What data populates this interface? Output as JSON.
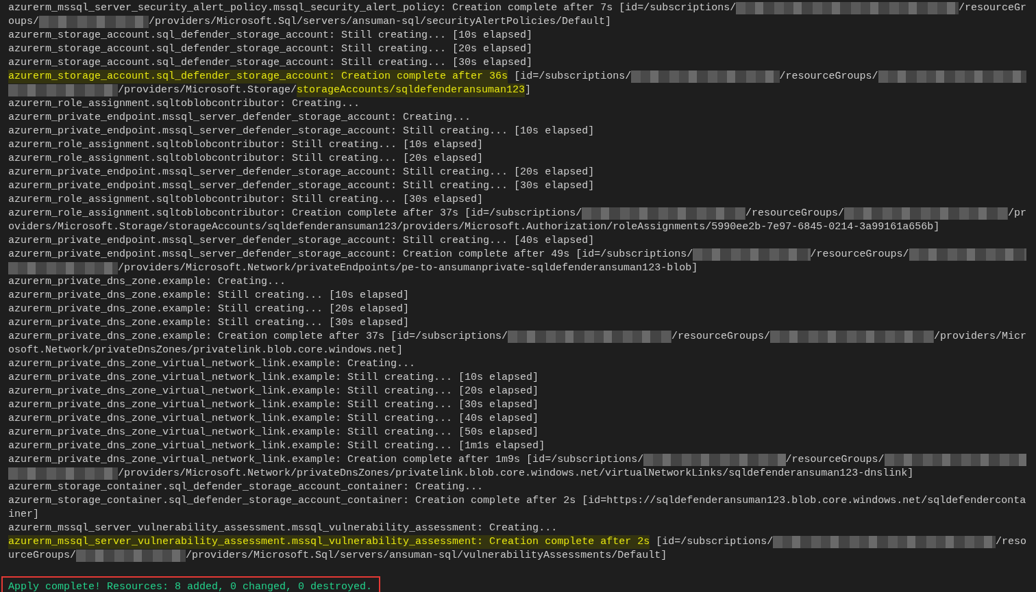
{
  "terminal": {
    "rows": [
      {
        "segments": [
          {
            "kind": "text",
            "text": "azurerm_mssql_server_security_alert_policy.mssql_security_alert_policy: Creation complete after 7s [id=/subscriptions/"
          },
          {
            "kind": "redacted"
          },
          {
            "kind": "text",
            "text": "/resourceGr"
          }
        ]
      },
      {
        "segments": [
          {
            "kind": "text",
            "text": "oups/"
          },
          {
            "kind": "redacted_short"
          },
          {
            "kind": "text",
            "text": "/providers/Microsoft.Sql/servers/ansuman-sql/securityAlertPolicies/Default]"
          }
        ]
      },
      {
        "segments": [
          {
            "kind": "text",
            "text": "azurerm_storage_account.sql_defender_storage_account: Still creating... [10s elapsed]"
          }
        ]
      },
      {
        "segments": [
          {
            "kind": "text",
            "text": "azurerm_storage_account.sql_defender_storage_account: Still creating... [20s elapsed]"
          }
        ]
      },
      {
        "segments": [
          {
            "kind": "text",
            "text": "azurerm_storage_account.sql_defender_storage_account: Still creating... [30s elapsed]"
          }
        ]
      },
      {
        "segments": [
          {
            "kind": "highlight",
            "text": "azurerm_storage_account.sql_defender_storage_account: Creation complete after 36s"
          },
          {
            "kind": "text",
            "text": " [id=/subscriptions/"
          },
          {
            "kind": "redacted"
          },
          {
            "kind": "text",
            "text": "/resourceGroups/"
          },
          {
            "kind": "redacted"
          }
        ]
      },
      {
        "segments": [
          {
            "kind": "redacted_short"
          },
          {
            "kind": "text",
            "text": "/providers/Microsoft.Storage/"
          },
          {
            "kind": "highlight",
            "text": "storageAccounts/sqldefenderansuman123"
          },
          {
            "kind": "text",
            "text": "]"
          }
        ]
      },
      {
        "segments": [
          {
            "kind": "text",
            "text": "azurerm_role_assignment.sqltoblobcontributor: Creating..."
          }
        ]
      },
      {
        "segments": [
          {
            "kind": "text",
            "text": "azurerm_private_endpoint.mssql_server_defender_storage_account: Creating..."
          }
        ]
      },
      {
        "segments": [
          {
            "kind": "text",
            "text": "azurerm_private_endpoint.mssql_server_defender_storage_account: Still creating... [10s elapsed]"
          }
        ]
      },
      {
        "segments": [
          {
            "kind": "text",
            "text": "azurerm_role_assignment.sqltoblobcontributor: Still creating... [10s elapsed]"
          }
        ]
      },
      {
        "segments": [
          {
            "kind": "text",
            "text": "azurerm_role_assignment.sqltoblobcontributor: Still creating... [20s elapsed]"
          }
        ]
      },
      {
        "segments": [
          {
            "kind": "text",
            "text": "azurerm_private_endpoint.mssql_server_defender_storage_account: Still creating... [20s elapsed]"
          }
        ]
      },
      {
        "segments": [
          {
            "kind": "text",
            "text": "azurerm_private_endpoint.mssql_server_defender_storage_account: Still creating... [30s elapsed]"
          }
        ]
      },
      {
        "segments": [
          {
            "kind": "text",
            "text": "azurerm_role_assignment.sqltoblobcontributor: Still creating... [30s elapsed]"
          }
        ]
      },
      {
        "segments": [
          {
            "kind": "text",
            "text": "azurerm_role_assignment.sqltoblobcontributor: Creation complete after 37s [id=/subscriptions/"
          },
          {
            "kind": "redacted"
          },
          {
            "kind": "text",
            "text": "/resourceGroups/"
          },
          {
            "kind": "redacted"
          },
          {
            "kind": "text",
            "text": "/pr"
          }
        ]
      },
      {
        "segments": [
          {
            "kind": "text",
            "text": "oviders/Microsoft.Storage/storageAccounts/sqldefenderansuman123/providers/Microsoft.Authorization/roleAssignments/5990ee2b-7e97-6845-0214-3a99161a656b]"
          }
        ]
      },
      {
        "segments": [
          {
            "kind": "text",
            "text": "azurerm_private_endpoint.mssql_server_defender_storage_account: Still creating... [40s elapsed]"
          }
        ]
      },
      {
        "segments": [
          {
            "kind": "text",
            "text": "azurerm_private_endpoint.mssql_server_defender_storage_account: Creation complete after 49s [id=/subscriptions/"
          },
          {
            "kind": "redacted"
          },
          {
            "kind": "text",
            "text": "/resourceGroups/"
          },
          {
            "kind": "redacted"
          }
        ]
      },
      {
        "segments": [
          {
            "kind": "redacted_short"
          },
          {
            "kind": "text",
            "text": "/providers/Microsoft.Network/privateEndpoints/pe-to-ansumanprivate-sqldefenderansuman123-blob]"
          }
        ]
      },
      {
        "segments": [
          {
            "kind": "text",
            "text": "azurerm_private_dns_zone.example: Creating..."
          }
        ]
      },
      {
        "segments": [
          {
            "kind": "text",
            "text": "azurerm_private_dns_zone.example: Still creating... [10s elapsed]"
          }
        ]
      },
      {
        "segments": [
          {
            "kind": "text",
            "text": "azurerm_private_dns_zone.example: Still creating... [20s elapsed]"
          }
        ]
      },
      {
        "segments": [
          {
            "kind": "text",
            "text": "azurerm_private_dns_zone.example: Still creating... [30s elapsed]"
          }
        ]
      },
      {
        "segments": [
          {
            "kind": "text",
            "text": "azurerm_private_dns_zone.example: Creation complete after 37s [id=/subscriptions/"
          },
          {
            "kind": "redacted"
          },
          {
            "kind": "text",
            "text": "/resourceGroups/"
          },
          {
            "kind": "redacted"
          },
          {
            "kind": "text",
            "text": "/providers/Micr"
          }
        ]
      },
      {
        "segments": [
          {
            "kind": "text",
            "text": "osoft.Network/privateDnsZones/privatelink.blob.core.windows.net]"
          }
        ]
      },
      {
        "segments": [
          {
            "kind": "text",
            "text": "azurerm_private_dns_zone_virtual_network_link.example: Creating..."
          }
        ]
      },
      {
        "segments": [
          {
            "kind": "text",
            "text": "azurerm_private_dns_zone_virtual_network_link.example: Still creating... [10s elapsed]"
          }
        ]
      },
      {
        "segments": [
          {
            "kind": "text",
            "text": "azurerm_private_dns_zone_virtual_network_link.example: Still creating... [20s elapsed]"
          }
        ]
      },
      {
        "segments": [
          {
            "kind": "text",
            "text": "azurerm_private_dns_zone_virtual_network_link.example: Still creating... [30s elapsed]"
          }
        ]
      },
      {
        "segments": [
          {
            "kind": "text",
            "text": "azurerm_private_dns_zone_virtual_network_link.example: Still creating... [40s elapsed]"
          }
        ]
      },
      {
        "segments": [
          {
            "kind": "text",
            "text": "azurerm_private_dns_zone_virtual_network_link.example: Still creating... [50s elapsed]"
          }
        ]
      },
      {
        "segments": [
          {
            "kind": "text",
            "text": "azurerm_private_dns_zone_virtual_network_link.example: Still creating... [1m1s elapsed]"
          }
        ]
      },
      {
        "segments": [
          {
            "kind": "text",
            "text": "azurerm_private_dns_zone_virtual_network_link.example: Creation complete after 1m9s [id=/subscriptions/"
          },
          {
            "kind": "redacted"
          },
          {
            "kind": "text",
            "text": "/resourceGroups/"
          },
          {
            "kind": "redacted"
          }
        ]
      },
      {
        "segments": [
          {
            "kind": "redacted_short"
          },
          {
            "kind": "text",
            "text": "/providers/Microsoft.Network/privateDnsZones/privatelink.blob.core.windows.net/virtualNetworkLinks/sqldefenderansuman123-dnslink]"
          }
        ]
      },
      {
        "segments": [
          {
            "kind": "text",
            "text": "azurerm_storage_container.sql_defender_storage_account_container: Creating..."
          }
        ]
      },
      {
        "segments": [
          {
            "kind": "text",
            "text": "azurerm_storage_container.sql_defender_storage_account_container: Creation complete after 2s [id=https://sqldefenderansuman123.blob.core.windows.net/sqldefenderconta"
          }
        ]
      },
      {
        "segments": [
          {
            "kind": "text",
            "text": "iner]"
          }
        ]
      },
      {
        "segments": [
          {
            "kind": "text",
            "text": "azurerm_mssql_server_vulnerability_assessment.mssql_vulnerability_assessment: Creating..."
          }
        ]
      },
      {
        "segments": [
          {
            "kind": "highlight",
            "text": "azurerm_mssql_server_vulnerability_assessment.mssql_vulnerability_assessment: Creation complete after 2s"
          },
          {
            "kind": "text",
            "text": " [id=/subscriptions/"
          },
          {
            "kind": "redacted"
          },
          {
            "kind": "text",
            "text": "/reso"
          }
        ]
      },
      {
        "segments": [
          {
            "kind": "text",
            "text": "urceGroups/"
          },
          {
            "kind": "redacted_short"
          },
          {
            "kind": "text",
            "text": "/providers/Microsoft.Sql/servers/ansuman-sql/vulnerabilityAssessments/Default]"
          }
        ]
      }
    ],
    "summary": {
      "text": "Apply complete! Resources: 8 added, 0 changed, 0 destroyed.",
      "boxed": true
    }
  }
}
